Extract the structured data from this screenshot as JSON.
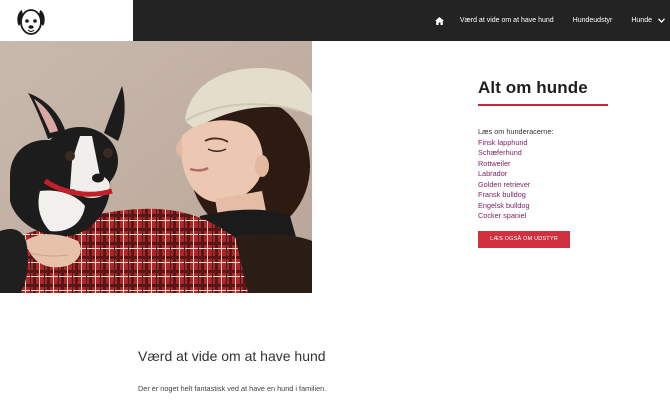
{
  "header": {
    "logo_icon": "dog-face-icon",
    "home_icon": "home-icon",
    "nav": [
      {
        "label": "Værd at vide om at have hund"
      },
      {
        "label": "Hundeudstyr"
      },
      {
        "label": "Hunde",
        "icon": "chevron-down-icon"
      }
    ]
  },
  "hero": {
    "image": "woman-holding-boston-terrier-photo"
  },
  "aside": {
    "title": "Alt om hunde",
    "intro": "Læs om hunderacerne:",
    "breeds": [
      "Finsk lapphund",
      "Schæferhund",
      "Rottweiler",
      "Labrador",
      "Golden retriever",
      "Fransk bulldog",
      "Engelsk bulldog",
      "Cocker spaniel"
    ],
    "cta_label": "LÆS OGSÅ OM UDSTYR"
  },
  "content": {
    "heading": "Værd at vide om at have hund",
    "paragraph": "Der er noget helt fantastisk ved at have en hund i familien."
  },
  "colors": {
    "topbar": "#232323",
    "accent": "#c8283c",
    "link": "#7a1d63"
  }
}
